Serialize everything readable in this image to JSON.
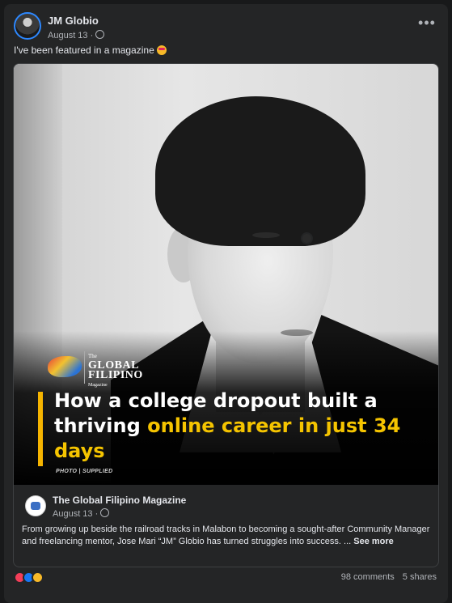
{
  "post": {
    "author": "JM Globio",
    "date": "August 13 ·",
    "caption": "I've been featured in a magazine",
    "caption_emoji": "star-struck-emoji",
    "more_label": "•••"
  },
  "article": {
    "magazine_logo": {
      "the": "The",
      "line1": "GLOBAL",
      "line2": "FILIPINO",
      "line3": "Magazine"
    },
    "headline_white_1": "How a college dropout built a thriving ",
    "headline_highlight": "online career in just 34 days",
    "photo_credit": "PHOTO | SUPPLIED",
    "accent_color": "#f5c400"
  },
  "link": {
    "source_name": "The Global Filipino Magazine",
    "source_date": "August 13 ·",
    "description": "From growing up beside the railroad tracks in Malabon to becoming a sought-after Community Manager and freelancing mentor, Jose Mari “JM” Globio has turned struggles into success. ...",
    "see_more": "See more"
  },
  "footer": {
    "reactions": [
      "love",
      "like",
      "wow"
    ],
    "comments": "98 comments",
    "shares": "5 shares"
  }
}
